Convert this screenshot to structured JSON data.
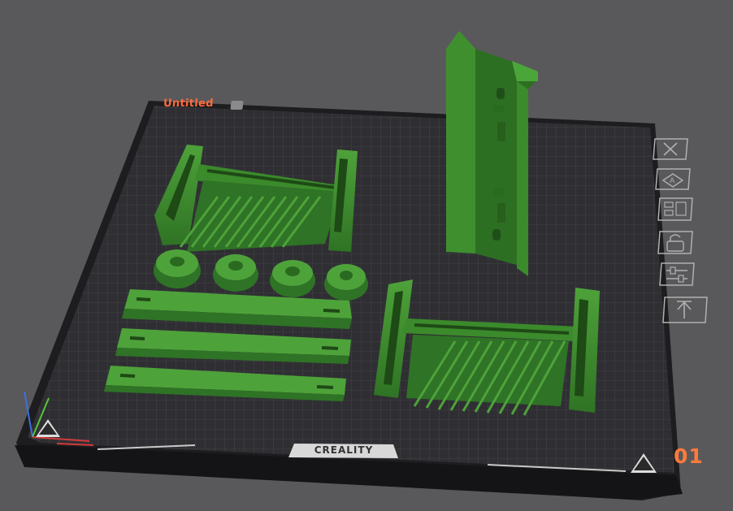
{
  "plate": {
    "title": "Untitled",
    "number": "01",
    "brand": "CREALITY",
    "title_color": "#ff6a3d",
    "number_color": "#ff7a3c",
    "model_color": "#3d8a2e"
  },
  "plate_tools": [
    {
      "name": "close-plate-button",
      "icon": "close-icon"
    },
    {
      "name": "auto-arrange-button",
      "icon": "arrange-icon"
    },
    {
      "name": "plate-settings-button",
      "icon": "settings-icon"
    },
    {
      "name": "lock-plate-button",
      "icon": "lock-icon"
    },
    {
      "name": "plate-parameters-button",
      "icon": "sliders-icon"
    },
    {
      "name": "move-to-top-button",
      "icon": "arrow-up-icon"
    }
  ]
}
